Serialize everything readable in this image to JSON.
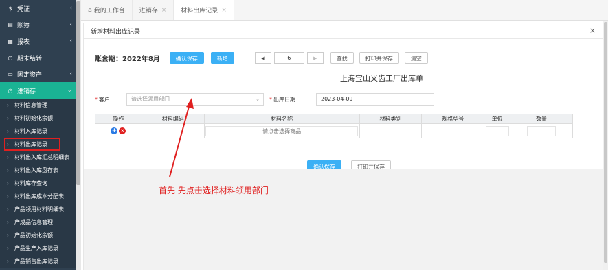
{
  "sidebar": {
    "top_items": [
      {
        "icon": "dollar-icon",
        "glyph": "$",
        "label": "凭证"
      },
      {
        "icon": "ledger-icon",
        "glyph": "▤",
        "label": "账簿"
      },
      {
        "icon": "report-icon",
        "glyph": "▦",
        "label": "报表"
      },
      {
        "icon": "clock-icon",
        "glyph": "◷",
        "label": "期末结转"
      },
      {
        "icon": "monitor-icon",
        "glyph": "▭",
        "label": "固定资产"
      }
    ],
    "active_item": {
      "icon": "inventory-icon",
      "glyph": "◷",
      "label": "进销存"
    },
    "sub_items": [
      "材料信息管理",
      "材料初始化余额",
      "材料入库记录",
      "材料出库记录",
      "材料出入库汇总明细表",
      "材料出入库盘存表",
      "材料库存查询",
      "材料出库成本分配表",
      "产品领用材料明细表",
      "产成品信息管理",
      "产品初始化余额",
      "产品生产入库记录",
      "产品销售出库记录"
    ],
    "selected_sub_index": 3
  },
  "tabs": [
    {
      "label": "我的工作台",
      "closable": false,
      "home": true
    },
    {
      "label": "进销存",
      "closable": true
    },
    {
      "label": "材料出库记录",
      "closable": true
    }
  ],
  "modal": {
    "title": "新增材料出库记录",
    "close_glyph": "×",
    "period_label": "账套期：2022年8月",
    "buttons": {
      "confirm_save": "确认保存",
      "add": "新增",
      "prev": "◀",
      "next": "▶",
      "page_value": "6",
      "search": "查找",
      "print_save": "打印并保存",
      "clear": "清空"
    },
    "doc_title": "上海宝山义齿工厂出库单",
    "form": {
      "customer_label": "客户",
      "customer_placeholder": "请选择领用部门",
      "date_label": "出库日期",
      "date_value": "2023-04-09"
    },
    "table": {
      "headers": [
        "操作",
        "材料编码",
        "材料名称",
        "材料类别",
        "规格型号",
        "单位",
        "数量"
      ],
      "row": {
        "name_placeholder": "请点击选择商品"
      }
    },
    "bottom_buttons": {
      "confirm_save": "确认保存",
      "print_save": "打印并保存"
    }
  },
  "annotation": "首先 先点击选择材料领用部门",
  "colors": {
    "sidebar_bg": "#2f4050",
    "active_green": "#1ab394",
    "primary_blue": "#3bb0f5",
    "annotation_red": "#e02020"
  }
}
